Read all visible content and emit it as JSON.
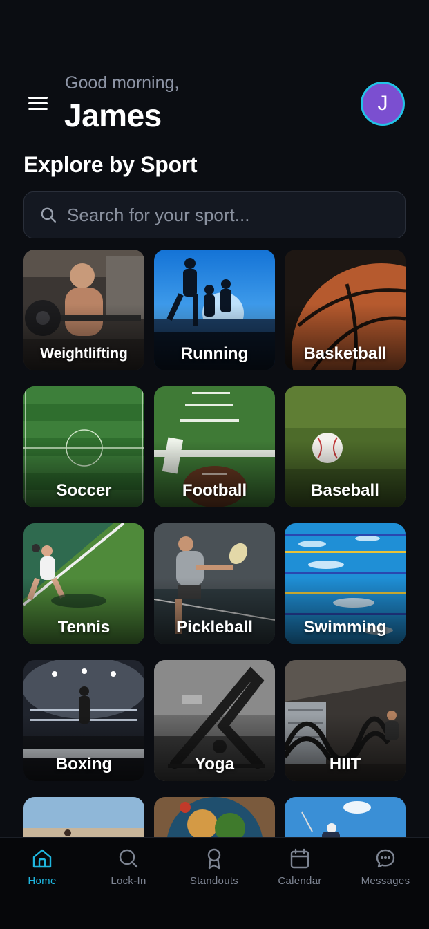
{
  "header": {
    "greeting": "Good morning,",
    "user_name": "James",
    "avatar_initial": "J",
    "avatar_color": "#7b4fd0",
    "avatar_ring_color": "#22c3e6"
  },
  "section": {
    "title": "Explore by Sport"
  },
  "search": {
    "placeholder": "Search for your sport...",
    "value": ""
  },
  "sports": [
    {
      "label": "Weightlifting",
      "icon": "weightlifting-photo"
    },
    {
      "label": "Running",
      "icon": "running-photo"
    },
    {
      "label": "Basketball",
      "icon": "basketball-photo"
    },
    {
      "label": "Soccer",
      "icon": "soccer-photo"
    },
    {
      "label": "Football",
      "icon": "football-photo"
    },
    {
      "label": "Baseball",
      "icon": "baseball-photo"
    },
    {
      "label": "Tennis",
      "icon": "tennis-photo"
    },
    {
      "label": "Pickleball",
      "icon": "pickleball-photo"
    },
    {
      "label": "Swimming",
      "icon": "swimming-photo"
    },
    {
      "label": "Boxing",
      "icon": "boxing-photo"
    },
    {
      "label": "Yoga",
      "icon": "yoga-photo"
    },
    {
      "label": "HIIT",
      "icon": "hiit-photo"
    }
  ],
  "nav": {
    "active_color": "#1fb7e0",
    "tabs": [
      {
        "label": "Home",
        "icon": "home-icon",
        "active": true
      },
      {
        "label": "Lock-In",
        "icon": "search-icon",
        "active": false
      },
      {
        "label": "Standouts",
        "icon": "award-icon",
        "active": false
      },
      {
        "label": "Calendar",
        "icon": "calendar-icon",
        "active": false
      },
      {
        "label": "Messages",
        "icon": "chat-bubble-icon",
        "active": false
      }
    ]
  }
}
